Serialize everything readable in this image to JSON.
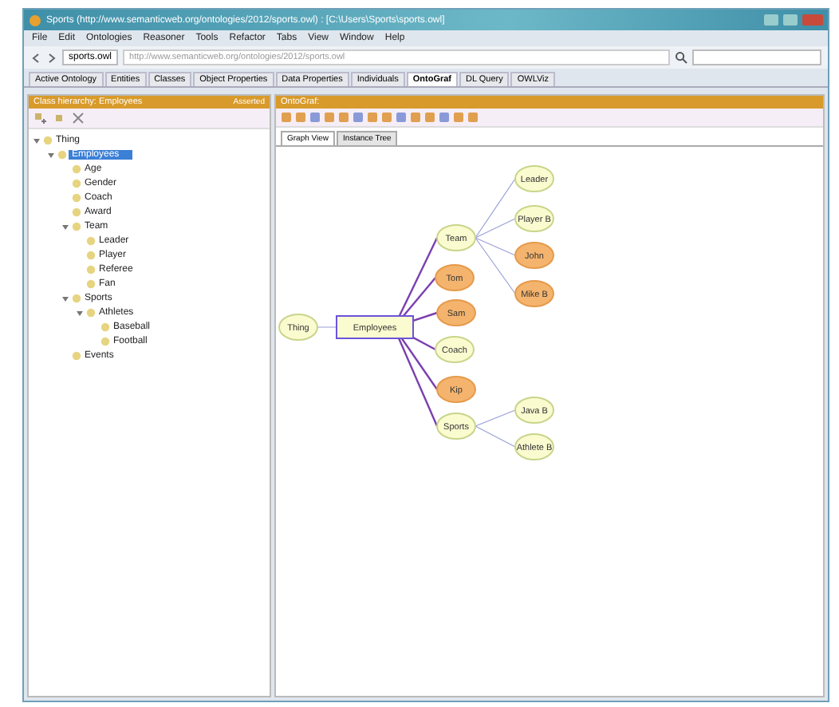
{
  "window": {
    "title": "Sports (http://www.semanticweb.org/ontologies/2012/sports.owl) : [C:\\Users\\Sports\\sports.owl]"
  },
  "menu": [
    "File",
    "Edit",
    "Ontologies",
    "Reasoner",
    "Tools",
    "Refactor",
    "Tabs",
    "View",
    "Window",
    "Help"
  ],
  "address_bar": {
    "ontology": "sports.owl",
    "url": "http://www.semanticweb.org/ontologies/2012/sports.owl"
  },
  "tabs": [
    {
      "label": "Active Ontology",
      "selected": false
    },
    {
      "label": "Entities",
      "selected": false
    },
    {
      "label": "Classes",
      "selected": false
    },
    {
      "label": "Object Properties",
      "selected": false
    },
    {
      "label": "Data Properties",
      "selected": false
    },
    {
      "label": "Individuals",
      "selected": false
    },
    {
      "label": "OntoGraf",
      "selected": true
    },
    {
      "label": "DL Query",
      "selected": false
    },
    {
      "label": "OWLViz",
      "selected": false
    }
  ],
  "class_panel": {
    "title": "Class hierarchy: Employees",
    "badge": "Asserted",
    "tree": [
      {
        "label": "Thing",
        "expanded": true,
        "selected": false,
        "children": [
          {
            "label": "Employees",
            "expanded": true,
            "selected": true,
            "children": [
              {
                "label": "Age",
                "selected": false
              },
              {
                "label": "Gender",
                "selected": false
              },
              {
                "label": "Coach",
                "selected": false
              },
              {
                "label": "Award",
                "selected": false
              },
              {
                "label": "Team",
                "expanded": true,
                "selected": false,
                "children": [
                  {
                    "label": "Leader",
                    "selected": false
                  },
                  {
                    "label": "Player",
                    "selected": false
                  },
                  {
                    "label": "Referee",
                    "selected": false
                  },
                  {
                    "label": "Fan",
                    "selected": false
                  }
                ]
              },
              {
                "label": "Sports",
                "expanded": true,
                "selected": false,
                "children": [
                  {
                    "label": "Athletes",
                    "expanded": true,
                    "selected": false,
                    "children": [
                      {
                        "label": "Baseball",
                        "selected": false
                      },
                      {
                        "label": "Football",
                        "selected": false
                      }
                    ]
                  }
                ]
              },
              {
                "label": "Events",
                "selected": false
              }
            ]
          }
        ]
      }
    ]
  },
  "graph_panel": {
    "title": "OntoGraf:",
    "subtabs": [
      {
        "label": "Graph View",
        "selected": true
      },
      {
        "label": "Instance Tree",
        "selected": false
      }
    ],
    "graph": {
      "label": "Thing",
      "kind": "class",
      "children": [
        {
          "label": "Employees",
          "kind": "focus",
          "children": [
            {
              "label": "Team",
              "kind": "class",
              "children": [
                {
                  "label": "Leader",
                  "kind": "class"
                },
                {
                  "label": "Player B",
                  "kind": "class"
                },
                {
                  "label": "John",
                  "kind": "individual"
                },
                {
                  "label": "Mike B",
                  "kind": "individual"
                }
              ]
            },
            {
              "label": "Tom",
              "kind": "individual"
            },
            {
              "label": "Sam",
              "kind": "individual"
            },
            {
              "label": "Coach",
              "kind": "class"
            },
            {
              "label": "Kip",
              "kind": "individual"
            },
            {
              "label": "Sports",
              "kind": "class",
              "children": [
                {
                  "label": "Java B",
                  "kind": "class"
                },
                {
                  "label": "Athlete B",
                  "kind": "class"
                }
              ]
            }
          ]
        }
      ]
    }
  }
}
